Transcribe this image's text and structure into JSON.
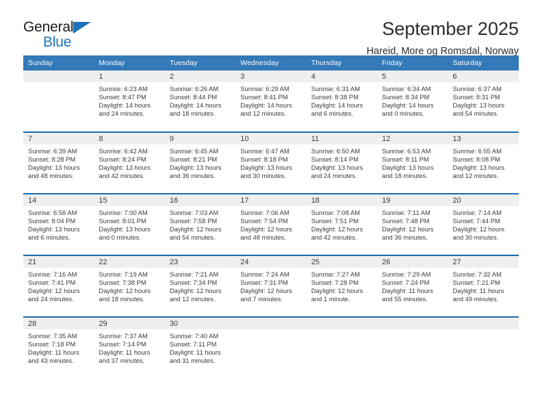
{
  "brand": {
    "name_part1": "General",
    "name_part2": "Blue",
    "triangle_color": "#1b72bd"
  },
  "header": {
    "title": "September 2025",
    "subtitle": "Hareid, More og Romsdal, Norway"
  },
  "theme": {
    "header_bg": "#3479b8",
    "row_divider": "#1b6aad",
    "daynum_bg": "#efefef",
    "text": "#3a3a3a"
  },
  "weekdays": [
    "Sunday",
    "Monday",
    "Tuesday",
    "Wednesday",
    "Thursday",
    "Friday",
    "Saturday"
  ],
  "labels": {
    "sunrise_prefix": "Sunrise:",
    "sunset_prefix": "Sunset:",
    "daylight_prefix": "Daylight:"
  },
  "weeks": [
    [
      {
        "day": "",
        "empty": true
      },
      {
        "day": "1",
        "sunrise": "Sunrise: 6:23 AM",
        "sunset": "Sunset: 8:47 PM",
        "daylight1": "Daylight: 14 hours",
        "daylight2": "and 24 minutes."
      },
      {
        "day": "2",
        "sunrise": "Sunrise: 6:26 AM",
        "sunset": "Sunset: 8:44 PM",
        "daylight1": "Daylight: 14 hours",
        "daylight2": "and 18 minutes."
      },
      {
        "day": "3",
        "sunrise": "Sunrise: 6:29 AM",
        "sunset": "Sunset: 8:41 PM",
        "daylight1": "Daylight: 14 hours",
        "daylight2": "and 12 minutes."
      },
      {
        "day": "4",
        "sunrise": "Sunrise: 6:31 AM",
        "sunset": "Sunset: 8:38 PM",
        "daylight1": "Daylight: 14 hours",
        "daylight2": "and 6 minutes."
      },
      {
        "day": "5",
        "sunrise": "Sunrise: 6:34 AM",
        "sunset": "Sunset: 8:34 PM",
        "daylight1": "Daylight: 14 hours",
        "daylight2": "and 0 minutes."
      },
      {
        "day": "6",
        "sunrise": "Sunrise: 6:37 AM",
        "sunset": "Sunset: 8:31 PM",
        "daylight1": "Daylight: 13 hours",
        "daylight2": "and 54 minutes."
      }
    ],
    [
      {
        "day": "7",
        "sunrise": "Sunrise: 6:39 AM",
        "sunset": "Sunset: 8:28 PM",
        "daylight1": "Daylight: 13 hours",
        "daylight2": "and 48 minutes."
      },
      {
        "day": "8",
        "sunrise": "Sunrise: 6:42 AM",
        "sunset": "Sunset: 8:24 PM",
        "daylight1": "Daylight: 13 hours",
        "daylight2": "and 42 minutes."
      },
      {
        "day": "9",
        "sunrise": "Sunrise: 6:45 AM",
        "sunset": "Sunset: 8:21 PM",
        "daylight1": "Daylight: 13 hours",
        "daylight2": "and 36 minutes."
      },
      {
        "day": "10",
        "sunrise": "Sunrise: 6:47 AM",
        "sunset": "Sunset: 8:18 PM",
        "daylight1": "Daylight: 13 hours",
        "daylight2": "and 30 minutes."
      },
      {
        "day": "11",
        "sunrise": "Sunrise: 6:50 AM",
        "sunset": "Sunset: 8:14 PM",
        "daylight1": "Daylight: 13 hours",
        "daylight2": "and 24 minutes."
      },
      {
        "day": "12",
        "sunrise": "Sunrise: 6:53 AM",
        "sunset": "Sunset: 8:11 PM",
        "daylight1": "Daylight: 13 hours",
        "daylight2": "and 18 minutes."
      },
      {
        "day": "13",
        "sunrise": "Sunrise: 6:55 AM",
        "sunset": "Sunset: 8:08 PM",
        "daylight1": "Daylight: 13 hours",
        "daylight2": "and 12 minutes."
      }
    ],
    [
      {
        "day": "14",
        "sunrise": "Sunrise: 6:58 AM",
        "sunset": "Sunset: 8:04 PM",
        "daylight1": "Daylight: 13 hours",
        "daylight2": "and 6 minutes."
      },
      {
        "day": "15",
        "sunrise": "Sunrise: 7:00 AM",
        "sunset": "Sunset: 8:01 PM",
        "daylight1": "Daylight: 13 hours",
        "daylight2": "and 0 minutes."
      },
      {
        "day": "16",
        "sunrise": "Sunrise: 7:03 AM",
        "sunset": "Sunset: 7:58 PM",
        "daylight1": "Daylight: 12 hours",
        "daylight2": "and 54 minutes."
      },
      {
        "day": "17",
        "sunrise": "Sunrise: 7:06 AM",
        "sunset": "Sunset: 7:54 PM",
        "daylight1": "Daylight: 12 hours",
        "daylight2": "and 48 minutes."
      },
      {
        "day": "18",
        "sunrise": "Sunrise: 7:08 AM",
        "sunset": "Sunset: 7:51 PM",
        "daylight1": "Daylight: 12 hours",
        "daylight2": "and 42 minutes."
      },
      {
        "day": "19",
        "sunrise": "Sunrise: 7:11 AM",
        "sunset": "Sunset: 7:48 PM",
        "daylight1": "Daylight: 12 hours",
        "daylight2": "and 36 minutes."
      },
      {
        "day": "20",
        "sunrise": "Sunrise: 7:14 AM",
        "sunset": "Sunset: 7:44 PM",
        "daylight1": "Daylight: 12 hours",
        "daylight2": "and 30 minutes."
      }
    ],
    [
      {
        "day": "21",
        "sunrise": "Sunrise: 7:16 AM",
        "sunset": "Sunset: 7:41 PM",
        "daylight1": "Daylight: 12 hours",
        "daylight2": "and 24 minutes."
      },
      {
        "day": "22",
        "sunrise": "Sunrise: 7:19 AM",
        "sunset": "Sunset: 7:38 PM",
        "daylight1": "Daylight: 12 hours",
        "daylight2": "and 18 minutes."
      },
      {
        "day": "23",
        "sunrise": "Sunrise: 7:21 AM",
        "sunset": "Sunset: 7:34 PM",
        "daylight1": "Daylight: 12 hours",
        "daylight2": "and 12 minutes."
      },
      {
        "day": "24",
        "sunrise": "Sunrise: 7:24 AM",
        "sunset": "Sunset: 7:31 PM",
        "daylight1": "Daylight: 12 hours",
        "daylight2": "and 7 minutes."
      },
      {
        "day": "25",
        "sunrise": "Sunrise: 7:27 AM",
        "sunset": "Sunset: 7:28 PM",
        "daylight1": "Daylight: 12 hours",
        "daylight2": "and 1 minute."
      },
      {
        "day": "26",
        "sunrise": "Sunrise: 7:29 AM",
        "sunset": "Sunset: 7:24 PM",
        "daylight1": "Daylight: 11 hours",
        "daylight2": "and 55 minutes."
      },
      {
        "day": "27",
        "sunrise": "Sunrise: 7:32 AM",
        "sunset": "Sunset: 7:21 PM",
        "daylight1": "Daylight: 11 hours",
        "daylight2": "and 49 minutes."
      }
    ],
    [
      {
        "day": "28",
        "sunrise": "Sunrise: 7:35 AM",
        "sunset": "Sunset: 7:18 PM",
        "daylight1": "Daylight: 11 hours",
        "daylight2": "and 43 minutes."
      },
      {
        "day": "29",
        "sunrise": "Sunrise: 7:37 AM",
        "sunset": "Sunset: 7:14 PM",
        "daylight1": "Daylight: 11 hours",
        "daylight2": "and 37 minutes."
      },
      {
        "day": "30",
        "sunrise": "Sunrise: 7:40 AM",
        "sunset": "Sunset: 7:11 PM",
        "daylight1": "Daylight: 11 hours",
        "daylight2": "and 31 minutes."
      },
      {
        "day": "",
        "empty": true
      },
      {
        "day": "",
        "empty": true
      },
      {
        "day": "",
        "empty": true
      },
      {
        "day": "",
        "empty": true
      }
    ]
  ]
}
